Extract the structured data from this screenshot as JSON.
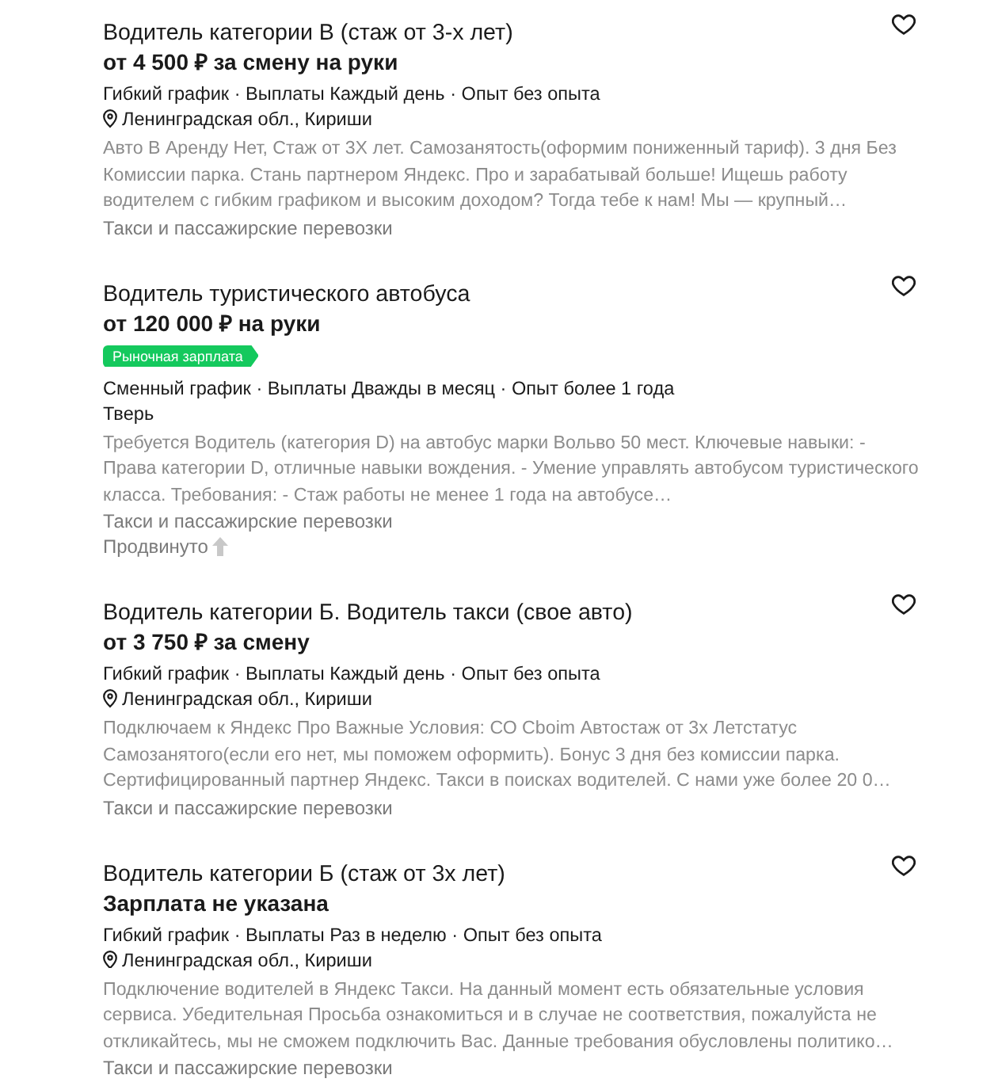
{
  "vacancies": [
    {
      "title": "Водитель категории В (стаж от 3-х лет)",
      "favorite": false,
      "salary": "от 4 500 ₽ за смену на руки",
      "conditions": "Гибкий график · Выплаты Каждый день · Опыт без опыта",
      "location": {
        "text": "Ленинградская обл., Кириши",
        "pin": true
      },
      "description": "Авто В Аренду Нет, Стаж от 3Х лет. Самозанятость(оформим пониженный тариф). 3 дня Без Комиссии парка. Стань партнером Яндекс. Про и зарабатывай больше! Ищешь работу водителем с гибким графиком и высоким доходом? Тогда тебе к нам! Мы — крупный…",
      "category": "Такси и пассажирские перевозки"
    },
    {
      "title": "Водитель туристического автобуса",
      "favorite": false,
      "salary": "от 120 000 ₽ на руки",
      "badge": "Рыночная зарплата",
      "conditions": "Сменный график · Выплаты Дважды в месяц · Опыт более 1 года",
      "location": {
        "text": "Тверь",
        "pin": false
      },
      "description": "Требуется Водитель (категория D) на автобус марки Вольво 50 мест. Ключевые навыки: - Права категории D, отличные навыки вождения. - Умение управлять автобусом туристического класса. Требования: - Стаж работы не менее 1 года на автобусе…",
      "category": "Такси и пассажирские перевозки",
      "promoted": "Продвинуто"
    },
    {
      "title": "Водитель категории Б. Водитель такси (свое авто)",
      "favorite": false,
      "salary": "от 3 750 ₽ за смену",
      "conditions": "Гибкий график · Выплаты Каждый день · Опыт без опыта",
      "location": {
        "text": "Ленинградская обл., Кириши",
        "pin": true
      },
      "description": "Подключаем к Яндекс Про Важные Условия: СО Сbоim Автостаж от 3х Летстатус Самозанятого(если его нет, мы поможем оформить). Бонус 3 дня без комиссии парка. Сертифицированный партнер Яндекс. Такси в поисках водителей. С нами уже более 20 0…",
      "category": "Такси и пассажирские перевозки"
    },
    {
      "title": "Водитель категории Б (стаж от 3х лет)",
      "favorite": false,
      "salary": "Зарплата не указана",
      "conditions": "Гибкий график · Выплаты Раз в неделю · Опыт без опыта",
      "location": {
        "text": "Ленинградская обл., Кириши",
        "pin": true
      },
      "description": "Подключение водителей в Яндекс Такси. На данный момент есть обязательные условия сервиса. Убедительная Просьба ознакомиться и в случае не соответствия, пожалуйста не откликайтесь, мы не сможем подключить Вас. Данные требования обусловлены политико…",
      "category": "Такси и пассажирские перевозки"
    }
  ]
}
